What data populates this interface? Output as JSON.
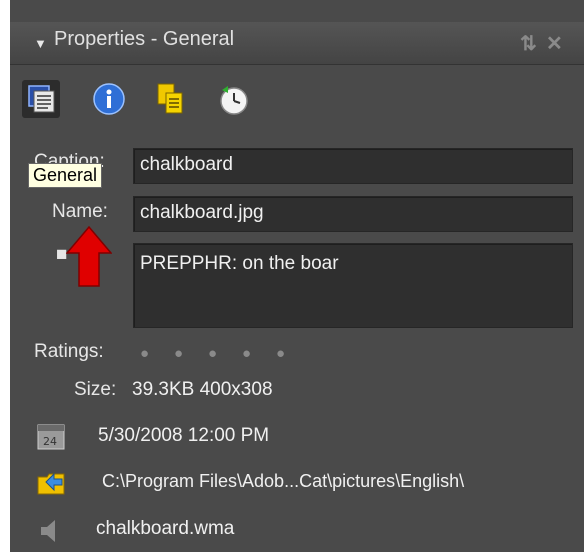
{
  "header": {
    "title": "Properties - General"
  },
  "toolbar": {
    "items": [
      {
        "icon": "general-icon",
        "active": true
      },
      {
        "icon": "info-icon",
        "active": false
      },
      {
        "icon": "tags-icon",
        "active": false
      },
      {
        "icon": "history-icon",
        "active": false
      }
    ]
  },
  "tooltip": {
    "text": "General"
  },
  "form": {
    "caption_label": "Caption:",
    "caption_value": "chalkboard",
    "name_label": "Name:",
    "name_value": "chalkboard.jpg",
    "notes_value": "PREPPHR: on the boar"
  },
  "ratings": {
    "label": "Ratings:",
    "value": 0,
    "max": 5
  },
  "info": {
    "size_label": "Size:",
    "size_value": "39.3KB  400x308",
    "date_value": "5/30/2008 12:00 PM",
    "path_value": "C:\\Program Files\\Adob...Cat\\pictures\\English\\",
    "audio_value": "chalkboard.wma"
  },
  "colors": {
    "panel_bg": "#4a4a4a",
    "field_bg": "#2f2f2f",
    "text": "#e6e6e6",
    "tooltip_bg": "#ffffe1",
    "arrow": "#e00000"
  }
}
